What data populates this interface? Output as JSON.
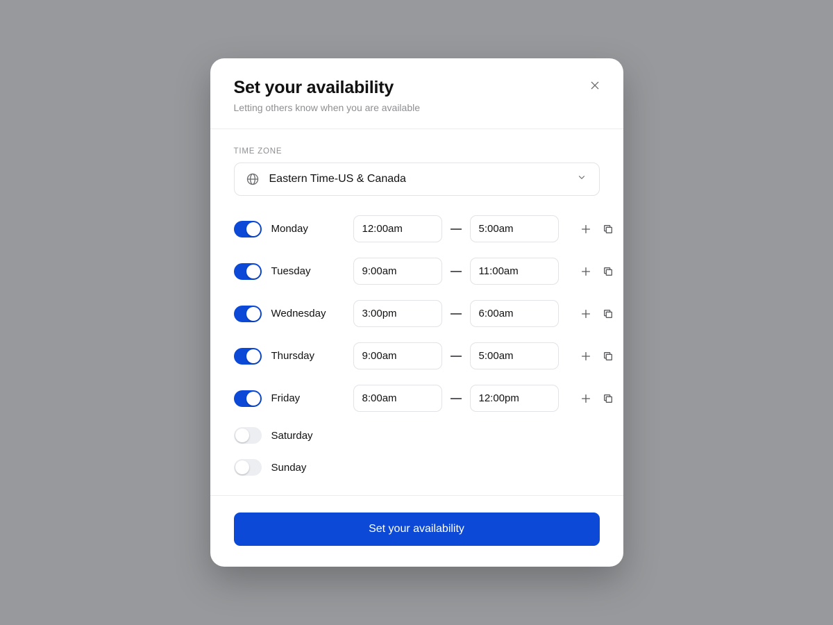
{
  "header": {
    "title": "Set your availability",
    "subtitle": "Letting others know when you are available"
  },
  "timezone": {
    "section_label": "TIME ZONE",
    "value": "Eastern Time-US & Canada"
  },
  "days": [
    {
      "label": "Monday",
      "enabled": true,
      "start": "12:00am",
      "end": "5:00am"
    },
    {
      "label": "Tuesday",
      "enabled": true,
      "start": "9:00am",
      "end": "11:00am"
    },
    {
      "label": "Wednesday",
      "enabled": true,
      "start": "3:00pm",
      "end": "6:00am"
    },
    {
      "label": "Thursday",
      "enabled": true,
      "start": "9:00am",
      "end": "5:00am"
    },
    {
      "label": "Friday",
      "enabled": true,
      "start": "8:00am",
      "end": "12:00pm"
    },
    {
      "label": "Saturday",
      "enabled": false,
      "start": "",
      "end": ""
    },
    {
      "label": "Sunday",
      "enabled": false,
      "start": "",
      "end": ""
    }
  ],
  "footer": {
    "submit_label": "Set your availability"
  },
  "colors": {
    "accent": "#0b49d6",
    "border": "#e2e3e6",
    "muted_text": "#8e8f92"
  },
  "icons": {
    "close": "close-icon",
    "globe": "globe-icon",
    "chevron_down": "chevron-down-icon",
    "plus": "plus-icon",
    "copy": "copy-icon",
    "dash": "dash-icon"
  }
}
